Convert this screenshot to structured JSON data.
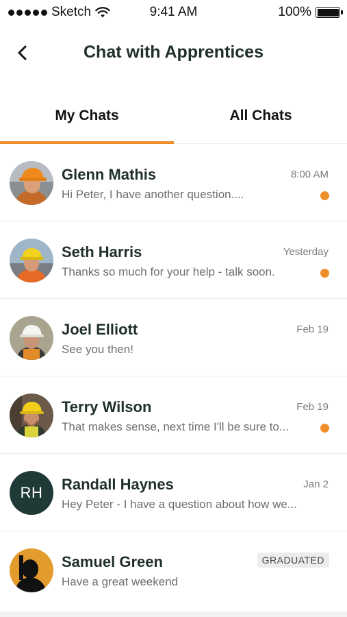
{
  "status_bar": {
    "carrier": "Sketch",
    "time": "9:41 AM",
    "battery": "100%"
  },
  "nav": {
    "title": "Chat with Apprentices",
    "back_icon": "chevron-left-icon"
  },
  "tabs": [
    {
      "label": "My Chats",
      "active": true
    },
    {
      "label": "All Chats",
      "active": false
    }
  ],
  "colors": {
    "accent": "#ee8f2a",
    "title": "#1f2f2c",
    "initials_bg": "#1f3a36",
    "badge_bg": "#ececec"
  },
  "chats": [
    {
      "name": "Glenn Mathis",
      "preview": "Hi Peter, I have another question....",
      "time": "8:00 AM",
      "unread": true
    },
    {
      "name": "Seth Harris",
      "preview": "Thanks so much for your help - talk soon.",
      "time": "Yesterday",
      "unread": true
    },
    {
      "name": "Joel Elliott",
      "preview": "See you then!",
      "time": "Feb 19",
      "unread": false
    },
    {
      "name": "Terry Wilson",
      "preview": "That makes sense, next time I'll be sure to...",
      "time": "Feb 19",
      "unread": true
    },
    {
      "name": "Randall Haynes",
      "preview": "Hey Peter - I have a question about how we...",
      "time": "Jan 2",
      "unread": false,
      "initials": "RH"
    },
    {
      "name": "Samuel Green",
      "preview": "Have a great weekend",
      "badge": "GRADUATED",
      "unread": false
    }
  ]
}
